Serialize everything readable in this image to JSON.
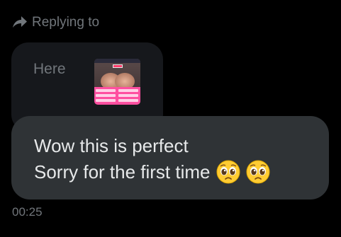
{
  "reply_context": {
    "label": "Replying to",
    "icon": "reply-arrow-icon"
  },
  "quoted_message": {
    "text": "Here",
    "attachment": "image-thumbnail"
  },
  "message": {
    "line1": "Wow this is perfect",
    "line2": "Sorry for the first time",
    "emojis": [
      "pleading-face-emoji",
      "pleading-face-emoji"
    ],
    "timestamp": "00:25"
  },
  "colors": {
    "background": "#000000",
    "quoted_bubble": "#16181c",
    "message_bubble": "#2f3336",
    "muted_text": "#71767b",
    "primary_text": "#e7e9ea"
  }
}
